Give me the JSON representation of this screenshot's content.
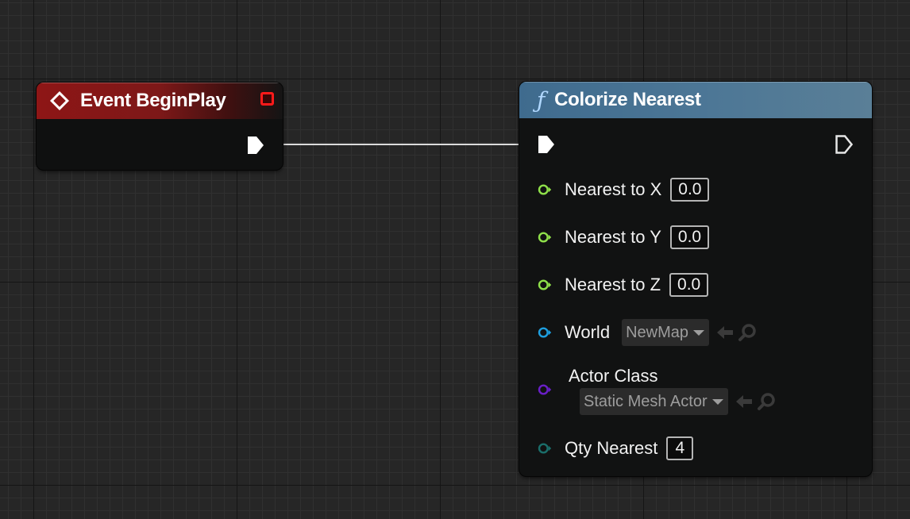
{
  "event_node": {
    "title": "Event BeginPlay"
  },
  "function_node": {
    "title": "Colorize Nearest",
    "inputs": {
      "nearest_x": {
        "label": "Nearest to X",
        "value": "0.0"
      },
      "nearest_y": {
        "label": "Nearest to Y",
        "value": "0.0"
      },
      "nearest_z": {
        "label": "Nearest to Z",
        "value": "0.0"
      },
      "world": {
        "label": "World",
        "value": "NewMap"
      },
      "actor_class": {
        "label": "Actor Class",
        "value": "Static Mesh Actor"
      },
      "qty_nearest": {
        "label": "Qty Nearest",
        "value": "4"
      }
    }
  },
  "colors": {
    "event_header": "#8e1616",
    "function_header": "#4d7796",
    "float_pin": "#8fe04a",
    "object_pin": "#1e9fe0",
    "class_pin": "#6a1fc8",
    "int_pin": "#1a6e6a"
  },
  "icons": {
    "event": "event-diamond-icon",
    "function": "function-f-icon",
    "use_selected": "arrow-left-icon",
    "browse": "magnifier-icon"
  }
}
